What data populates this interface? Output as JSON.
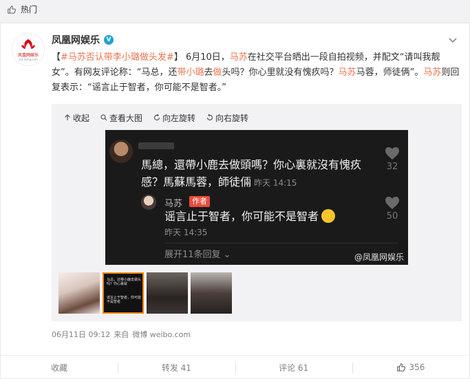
{
  "hot_bar": {
    "label": "热门",
    "icon": "thumb-up-outline-icon"
  },
  "post": {
    "author": {
      "name": "凤凰网娱乐",
      "verified_icon": "verified-v-icon",
      "logo_text": "凤凰网娱乐",
      "logo_url": "ent.ifeng.com"
    },
    "text": {
      "topic": "#马苏否认带李小璐做头发#",
      "p1": " 6月10日，",
      "hl1": "马苏",
      "p2": "在社交平台晒出一段自拍视频，并配文“请叫我靓女”。有网友评论称：“马总，还",
      "hl2": "带小璐",
      "p3": "去",
      "hl3": "做",
      "p4": "头吗？你心里就没有愧疚吗？",
      "hl4": "马苏",
      "p5": "马蓉，师徒俩”。",
      "hl5": "马苏",
      "p6": "则回复表示：“谣言止于智者，你可能不是智者。”"
    },
    "image_toolbar": {
      "collapse": "收起",
      "view_large": "查看大图",
      "rotate_left": "向左旋转",
      "rotate_right": "向右旋转"
    },
    "screenshot": {
      "comment1_text": "馬總，還帶小鹿去做頭嗎？你心裏就沒有愧疚感？馬蘇馬蓉，師徒倆",
      "comment1_time": "昨天 14:15",
      "comment1_likes": "32",
      "reply_name": "马苏",
      "reply_tag": "作者",
      "reply_text": "谣言止于智者，你可能不是智者",
      "reply_time": "昨天 14:35",
      "reply_likes": "50",
      "expand_text": "展开11条回复 ⌄",
      "watermark": "@凤凰网娱乐"
    },
    "thumbnails": {
      "t2_line1": "马总，还带小鹿去做头吗？你心裏就",
      "t2_line2": "谣言止于智者，你可能不是智者"
    },
    "meta": {
      "date": "06月11日 09:12",
      "from": "来自",
      "source": "微博 weibo.com"
    },
    "actions": {
      "collect": "收藏",
      "repost": "转发 41",
      "comment": "评论 61",
      "like": "356"
    }
  }
}
